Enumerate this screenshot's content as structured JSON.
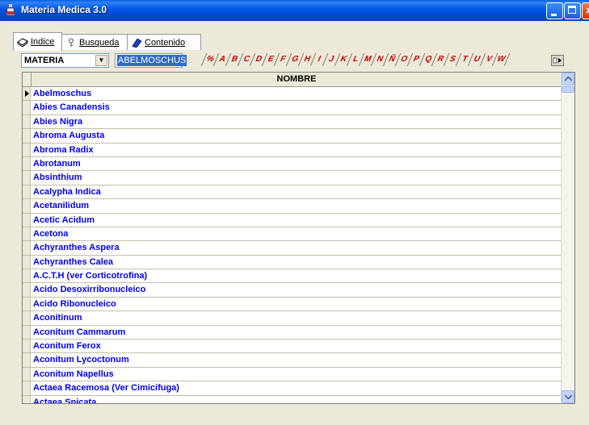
{
  "window": {
    "title": "Materia Medica 3.0"
  },
  "tabs": [
    {
      "label": "Indice",
      "icon": "book-icon"
    },
    {
      "label": "Busqueda",
      "icon": "key-icon"
    },
    {
      "label": "Contenido",
      "icon": "diamond-icon"
    }
  ],
  "toolbar": {
    "field_select": "MATERIA",
    "search_value": "ABELMOSCHUS",
    "letters": [
      "%",
      "A",
      "B",
      "C",
      "D",
      "E",
      "F",
      "G",
      "H",
      "I",
      "J",
      "K",
      "L",
      "M",
      "N",
      "Ñ",
      "O",
      "P",
      "Q",
      "R",
      "S",
      "T",
      "U",
      "V",
      "W"
    ]
  },
  "grid": {
    "column_header": "NOMBRE",
    "current_row": 0,
    "rows": [
      "Abelmoschus",
      "Abies Canadensis",
      "Abies Nigra",
      "Abroma Augusta",
      "Abroma Radix",
      "Abrotanum",
      "Absinthium",
      "Acalypha Indica",
      "Acetanilidum",
      "Acetic Acidum",
      "Acetona",
      "Achyranthes Aspera",
      "Achyranthes Calea",
      "A.C.T.H (ver Corticotrofina)",
      "Acido Desoxirribonucleico",
      "Acido Ribonucleico",
      "Aconitinum",
      "Aconitum Cammarum",
      "Aconitum Ferox",
      "Aconitum Lycoctonum",
      "Aconitum Napellus",
      "Actaea Racemosa (Ver Cimicifuga)",
      "Actaea Spicata"
    ]
  },
  "colors": {
    "titlebar": "#0054e3",
    "row_text": "#0000e6",
    "letter_text": "#c00000",
    "selection": "#316ac5"
  }
}
